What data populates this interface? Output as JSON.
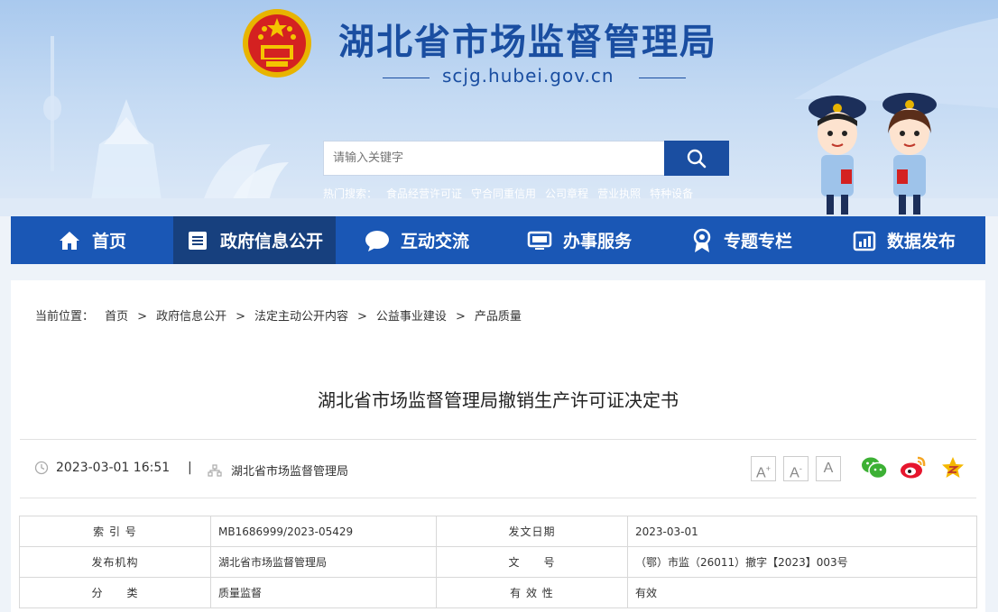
{
  "header": {
    "site_title": "湖北省市场监督管理局",
    "site_url": "scjg.hubei.gov.cn",
    "search_placeholder": "请输入关键字",
    "hot_label": "热门搜索：",
    "hot_terms": [
      "食品经营许可证",
      "守合同重信用",
      "公司章程",
      "营业执照",
      "特种设备"
    ]
  },
  "nav": {
    "items": [
      {
        "label": "首页",
        "icon": "home-icon"
      },
      {
        "label": "政府信息公开",
        "icon": "document-icon"
      },
      {
        "label": "互动交流",
        "icon": "chat-icon"
      },
      {
        "label": "办事服务",
        "icon": "monitor-icon"
      },
      {
        "label": "专题专栏",
        "icon": "award-icon"
      },
      {
        "label": "数据发布",
        "icon": "chart-icon"
      }
    ],
    "active_index": 1
  },
  "breadcrumb": {
    "label": "当前位置：",
    "items": [
      "首页",
      "政府信息公开",
      "法定主动公开内容",
      "公益事业建设",
      "产品质量"
    ],
    "separator": ">"
  },
  "article": {
    "title": "湖北省市场监督管理局撤销生产许可证决定书",
    "datetime": "2023-03-01 16:51",
    "divider": "|",
    "source": "湖北省市场监督管理局",
    "font_sizes": [
      "A+",
      "A-",
      "A"
    ]
  },
  "info_table": {
    "rows": [
      {
        "label1": "索 引 号",
        "value1": "MB1686999/2023-05429",
        "label2": "发文日期",
        "value2": "2023-03-01"
      },
      {
        "label1": "发布机构",
        "value1": "湖北省市场监督管理局",
        "label2": "文　　号",
        "value2": "（鄂）市监（26011）撤字【2023】003号"
      },
      {
        "label1": "分　　类",
        "value1": "质量监督",
        "label2": "有 效 性",
        "value2": "有效"
      }
    ]
  },
  "colors": {
    "brand_blue": "#1a4ea1",
    "nav_blue": "#1a57b5",
    "nav_active": "#17407e"
  }
}
